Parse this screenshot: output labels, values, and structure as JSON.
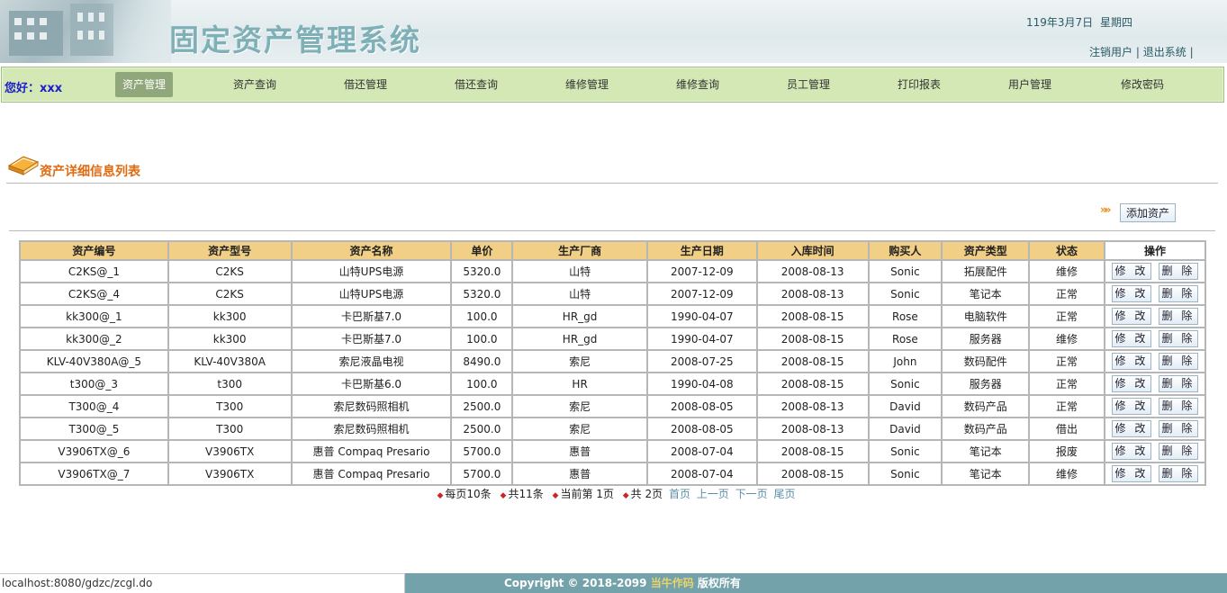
{
  "header": {
    "title": "固定资产管理系统",
    "date": "119年3月7日",
    "weekday": "星期四",
    "logout_user_label": "注销用户",
    "exit_label": "退出系统",
    "separator": "|"
  },
  "nav": {
    "greeting": "您好：xxx",
    "items": [
      "资产管理",
      "资产查询",
      "借还管理",
      "借还查询",
      "维修管理",
      "维修查询",
      "员工管理",
      "打印报表",
      "用户管理",
      "修改密码"
    ],
    "active_index": 0
  },
  "section": {
    "title": "资产详细信息列表",
    "add_button": "添加资产"
  },
  "table": {
    "headers": [
      "资产编号",
      "资产型号",
      "资产名称",
      "单价",
      "生产厂商",
      "生产日期",
      "入库时间",
      "购买人",
      "资产类型",
      "状态",
      "操作"
    ],
    "edit_label": "修 改",
    "delete_label": "删 除",
    "rows": [
      [
        "C2KS@_1",
        "C2KS",
        "山特UPS电源",
        "5320.0",
        "山特",
        "2007-12-09",
        "2008-08-13",
        "Sonic",
        "拓展配件",
        "维修"
      ],
      [
        "C2KS@_4",
        "C2KS",
        "山特UPS电源",
        "5320.0",
        "山特",
        "2007-12-09",
        "2008-08-13",
        "Sonic",
        "笔记本",
        "正常"
      ],
      [
        "kk300@_1",
        "kk300",
        "卡巴斯基7.0",
        "100.0",
        "HR_gd",
        "1990-04-07",
        "2008-08-15",
        "Rose",
        "电脑软件",
        "正常"
      ],
      [
        "kk300@_2",
        "kk300",
        "卡巴斯基7.0",
        "100.0",
        "HR_gd",
        "1990-04-07",
        "2008-08-15",
        "Rose",
        "服务器",
        "维修"
      ],
      [
        "KLV-40V380A@_5",
        "KLV-40V380A",
        "索尼液晶电视",
        "8490.0",
        "索尼",
        "2008-07-25",
        "2008-08-15",
        "John",
        "数码配件",
        "正常"
      ],
      [
        "t300@_3",
        "t300",
        "卡巴斯基6.0",
        "100.0",
        "HR",
        "1990-04-08",
        "2008-08-15",
        "Sonic",
        "服务器",
        "正常"
      ],
      [
        "T300@_4",
        "T300",
        "索尼数码照相机",
        "2500.0",
        "索尼",
        "2008-08-05",
        "2008-08-13",
        "David",
        "数码产品",
        "正常"
      ],
      [
        "T300@_5",
        "T300",
        "索尼数码照相机",
        "2500.0",
        "索尼",
        "2008-08-05",
        "2008-08-13",
        "David",
        "数码产品",
        "借出"
      ],
      [
        "V3906TX@_6",
        "V3906TX",
        "惠普 Compaq Presario",
        "5700.0",
        "惠普",
        "2008-07-04",
        "2008-08-15",
        "Sonic",
        "笔记本",
        "报废"
      ],
      [
        "V3906TX@_7",
        "V3906TX",
        "惠普 Compaq Presario",
        "5700.0",
        "惠普",
        "2008-07-04",
        "2008-08-15",
        "Sonic",
        "笔记本",
        "维修"
      ]
    ]
  },
  "pager": {
    "per_page": "每页10条",
    "total": "共11条",
    "current": "当前第 1页",
    "pages": "共 2页",
    "first": "首页",
    "prev": "上一页",
    "next": "下一页",
    "last": "尾页"
  },
  "status_bar": {
    "url": "localhost:8080/gdzc/zcgl.do"
  },
  "footer": {
    "copyright": "Copyright © 2018-2099",
    "author": "当牛作码",
    "rights": "版权所有"
  },
  "colors": {
    "nav_bg": "#d4e8b5",
    "nav_active": "#8fa77a",
    "table_header": "#f1cf86",
    "section_title": "#e06a10",
    "footer_bg": "#74a2ab"
  }
}
